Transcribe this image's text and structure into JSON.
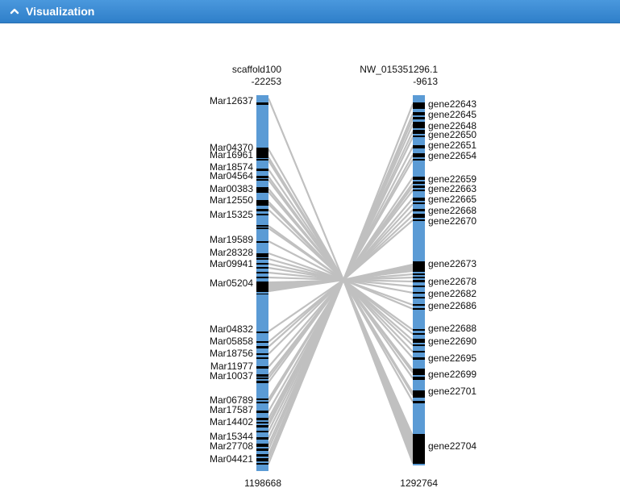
{
  "header": {
    "title": "Visualization",
    "icon": "chevron-up-icon"
  },
  "colors": {
    "chromosome": "#5b9bd5",
    "link": "#c0c0c0",
    "feature": "#000000"
  },
  "left": {
    "name": "scaffold100",
    "start": "-22253",
    "end": "1198668",
    "labels": [
      "Mar12637",
      "Mar04370",
      "Mar16961",
      "Mar18574",
      "Mar04564",
      "Mar00383",
      "Mar12550",
      "Mar15325",
      "Mar19589",
      "Mar28328",
      "Mar09941",
      "Mar05204",
      "Mar04832",
      "Mar05858",
      "Mar18756",
      "Mar11977",
      "Mar10037",
      "Mar06789",
      "Mar17587",
      "Mar14402",
      "Mar15344",
      "Mar27708",
      "Mar04421"
    ]
  },
  "right": {
    "name": "NW_015351296.1",
    "start": "-9613",
    "end": "1292764",
    "labels": [
      "gene22643",
      "gene22645",
      "gene22648",
      "gene22650",
      "gene22651",
      "gene22654",
      "gene22659",
      "gene22663",
      "gene22665",
      "gene22668",
      "gene22670",
      "gene22673",
      "gene22678",
      "gene22682",
      "gene22686",
      "gene22688",
      "gene22690",
      "gene22695",
      "gene22699",
      "gene22701",
      "gene22704"
    ]
  }
}
